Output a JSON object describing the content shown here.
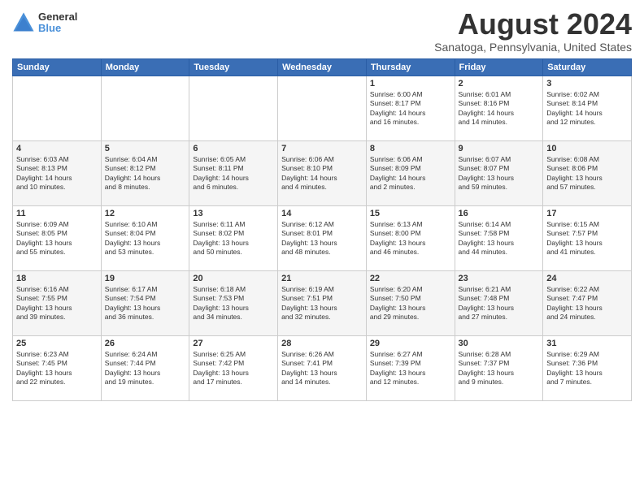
{
  "header": {
    "logo_general": "General",
    "logo_blue": "Blue",
    "month_year": "August 2024",
    "location": "Sanatoga, Pennsylvania, United States"
  },
  "calendar": {
    "days_of_week": [
      "Sunday",
      "Monday",
      "Tuesday",
      "Wednesday",
      "Thursday",
      "Friday",
      "Saturday"
    ],
    "weeks": [
      [
        {
          "day": "",
          "info": ""
        },
        {
          "day": "",
          "info": ""
        },
        {
          "day": "",
          "info": ""
        },
        {
          "day": "",
          "info": ""
        },
        {
          "day": "1",
          "info": "Sunrise: 6:00 AM\nSunset: 8:17 PM\nDaylight: 14 hours\nand 16 minutes."
        },
        {
          "day": "2",
          "info": "Sunrise: 6:01 AM\nSunset: 8:16 PM\nDaylight: 14 hours\nand 14 minutes."
        },
        {
          "day": "3",
          "info": "Sunrise: 6:02 AM\nSunset: 8:14 PM\nDaylight: 14 hours\nand 12 minutes."
        }
      ],
      [
        {
          "day": "4",
          "info": "Sunrise: 6:03 AM\nSunset: 8:13 PM\nDaylight: 14 hours\nand 10 minutes."
        },
        {
          "day": "5",
          "info": "Sunrise: 6:04 AM\nSunset: 8:12 PM\nDaylight: 14 hours\nand 8 minutes."
        },
        {
          "day": "6",
          "info": "Sunrise: 6:05 AM\nSunset: 8:11 PM\nDaylight: 14 hours\nand 6 minutes."
        },
        {
          "day": "7",
          "info": "Sunrise: 6:06 AM\nSunset: 8:10 PM\nDaylight: 14 hours\nand 4 minutes."
        },
        {
          "day": "8",
          "info": "Sunrise: 6:06 AM\nSunset: 8:09 PM\nDaylight: 14 hours\nand 2 minutes."
        },
        {
          "day": "9",
          "info": "Sunrise: 6:07 AM\nSunset: 8:07 PM\nDaylight: 13 hours\nand 59 minutes."
        },
        {
          "day": "10",
          "info": "Sunrise: 6:08 AM\nSunset: 8:06 PM\nDaylight: 13 hours\nand 57 minutes."
        }
      ],
      [
        {
          "day": "11",
          "info": "Sunrise: 6:09 AM\nSunset: 8:05 PM\nDaylight: 13 hours\nand 55 minutes."
        },
        {
          "day": "12",
          "info": "Sunrise: 6:10 AM\nSunset: 8:04 PM\nDaylight: 13 hours\nand 53 minutes."
        },
        {
          "day": "13",
          "info": "Sunrise: 6:11 AM\nSunset: 8:02 PM\nDaylight: 13 hours\nand 50 minutes."
        },
        {
          "day": "14",
          "info": "Sunrise: 6:12 AM\nSunset: 8:01 PM\nDaylight: 13 hours\nand 48 minutes."
        },
        {
          "day": "15",
          "info": "Sunrise: 6:13 AM\nSunset: 8:00 PM\nDaylight: 13 hours\nand 46 minutes."
        },
        {
          "day": "16",
          "info": "Sunrise: 6:14 AM\nSunset: 7:58 PM\nDaylight: 13 hours\nand 44 minutes."
        },
        {
          "day": "17",
          "info": "Sunrise: 6:15 AM\nSunset: 7:57 PM\nDaylight: 13 hours\nand 41 minutes."
        }
      ],
      [
        {
          "day": "18",
          "info": "Sunrise: 6:16 AM\nSunset: 7:55 PM\nDaylight: 13 hours\nand 39 minutes."
        },
        {
          "day": "19",
          "info": "Sunrise: 6:17 AM\nSunset: 7:54 PM\nDaylight: 13 hours\nand 36 minutes."
        },
        {
          "day": "20",
          "info": "Sunrise: 6:18 AM\nSunset: 7:53 PM\nDaylight: 13 hours\nand 34 minutes."
        },
        {
          "day": "21",
          "info": "Sunrise: 6:19 AM\nSunset: 7:51 PM\nDaylight: 13 hours\nand 32 minutes."
        },
        {
          "day": "22",
          "info": "Sunrise: 6:20 AM\nSunset: 7:50 PM\nDaylight: 13 hours\nand 29 minutes."
        },
        {
          "day": "23",
          "info": "Sunrise: 6:21 AM\nSunset: 7:48 PM\nDaylight: 13 hours\nand 27 minutes."
        },
        {
          "day": "24",
          "info": "Sunrise: 6:22 AM\nSunset: 7:47 PM\nDaylight: 13 hours\nand 24 minutes."
        }
      ],
      [
        {
          "day": "25",
          "info": "Sunrise: 6:23 AM\nSunset: 7:45 PM\nDaylight: 13 hours\nand 22 minutes."
        },
        {
          "day": "26",
          "info": "Sunrise: 6:24 AM\nSunset: 7:44 PM\nDaylight: 13 hours\nand 19 minutes."
        },
        {
          "day": "27",
          "info": "Sunrise: 6:25 AM\nSunset: 7:42 PM\nDaylight: 13 hours\nand 17 minutes."
        },
        {
          "day": "28",
          "info": "Sunrise: 6:26 AM\nSunset: 7:41 PM\nDaylight: 13 hours\nand 14 minutes."
        },
        {
          "day": "29",
          "info": "Sunrise: 6:27 AM\nSunset: 7:39 PM\nDaylight: 13 hours\nand 12 minutes."
        },
        {
          "day": "30",
          "info": "Sunrise: 6:28 AM\nSunset: 7:37 PM\nDaylight: 13 hours\nand 9 minutes."
        },
        {
          "day": "31",
          "info": "Sunrise: 6:29 AM\nSunset: 7:36 PM\nDaylight: 13 hours\nand 7 minutes."
        }
      ]
    ]
  }
}
